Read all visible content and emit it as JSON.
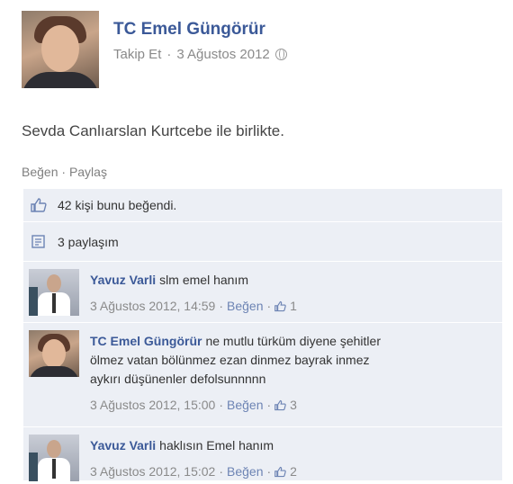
{
  "post": {
    "author": "TC Emel Güngörür",
    "follow": "Takip Et",
    "separator": "·",
    "date": "3 Ağustos 2012",
    "privacy_icon": "globe-icon",
    "text": "Sevda Canlıarslan Kurtcebe ile birlikte.",
    "actions": {
      "like": "Beğen",
      "dot": "·",
      "share": "Paylaş"
    }
  },
  "summary": {
    "likes": "42 kişi bunu beğendi.",
    "shares": "3 paylaşım"
  },
  "comments": [
    {
      "author": "Yavuz Varli",
      "text": "slm emel hanım",
      "time": "3 Ağustos 2012, 14:59",
      "like": "Beğen",
      "count": "1"
    },
    {
      "author": "TC Emel Güngörür",
      "text": "ne mutlu türküm diyene şehitler",
      "text2": "ölmez vatan bölünmez ezan dinmez bayrak inmez",
      "text3": "aykırı düşünenler defolsunnnnn",
      "time": "3 Ağustos 2012, 15:00",
      "like": "Beğen",
      "count": "3"
    },
    {
      "author": "Yavuz Varli",
      "text": "haklısın Emel hanım",
      "time": "3 Ağustos 2012, 15:02",
      "like": "Beğen",
      "count": "2"
    }
  ],
  "meta_sep": "·",
  "colors": {
    "link": "#3b5998",
    "panel": "#eceff5",
    "muted": "#8a8a8a"
  }
}
